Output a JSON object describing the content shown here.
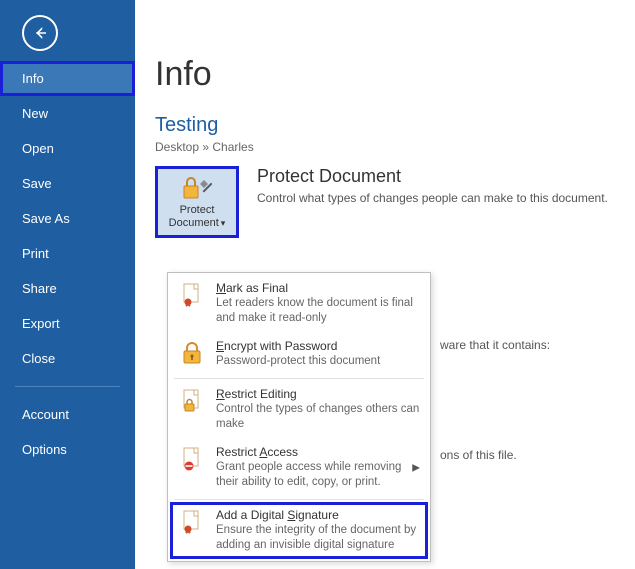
{
  "sidebar": {
    "items": [
      {
        "label": "Info",
        "selected": true
      },
      {
        "label": "New"
      },
      {
        "label": "Open"
      },
      {
        "label": "Save"
      },
      {
        "label": "Save As"
      },
      {
        "label": "Print"
      },
      {
        "label": "Share"
      },
      {
        "label": "Export"
      },
      {
        "label": "Close"
      }
    ],
    "footer": [
      {
        "label": "Account"
      },
      {
        "label": "Options"
      }
    ]
  },
  "page_title": "Info",
  "doc_title": "Testing",
  "breadcrumb": "Desktop » Charles",
  "protect_button": {
    "line1": "Protect",
    "line2": "Document"
  },
  "section": {
    "title": "Protect Document",
    "desc": "Control what types of changes people can make to this document."
  },
  "dropdown": [
    {
      "title_pre": "",
      "title_ul": "M",
      "title_post": "ark as Final",
      "desc": "Let readers know the document is final and make it read-only"
    },
    {
      "title_pre": "",
      "title_ul": "E",
      "title_post": "ncrypt with Password",
      "desc": "Password-protect this document"
    },
    {
      "title_pre": "",
      "title_ul": "R",
      "title_post": "estrict Editing",
      "desc": "Control the types of changes others can make"
    },
    {
      "title_pre": "Restrict ",
      "title_ul": "A",
      "title_post": "ccess",
      "desc": "Grant people access while removing their ability to edit, copy, or print.",
      "submenu": true
    },
    {
      "title_pre": "Add a Digital ",
      "title_ul": "S",
      "title_post": "ignature",
      "desc": "Ensure the integrity of the document by adding an invisible digital signature",
      "highlighted": true
    }
  ],
  "bg_text1": "ware that it contains:",
  "bg_text2": "ons of this file."
}
